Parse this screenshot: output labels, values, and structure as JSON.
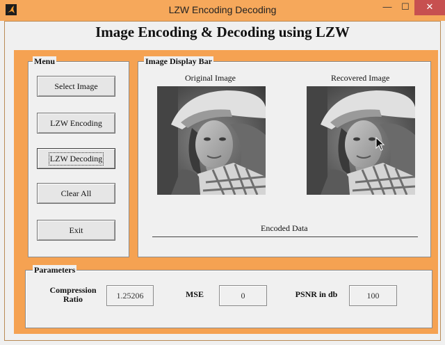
{
  "window": {
    "title": "LZW Encoding Decoding",
    "controls": {
      "minimize": "—",
      "maximize": "☐",
      "close": "✕"
    }
  },
  "heading": "Image Encoding & Decoding using LZW",
  "menu": {
    "title": "Menu",
    "buttons": [
      "Select Image",
      "LZW Encoding",
      "LZW Decoding",
      "Clear All",
      "Exit"
    ]
  },
  "display": {
    "title": "Image Display Bar",
    "original_label": "Original Image",
    "recovered_label": "Recovered Image",
    "encoded_label": "Encoded Data"
  },
  "parameters": {
    "title": "Parameters",
    "compression_label": "Compression Ratio",
    "compression_value": "1.25206",
    "mse_label": "MSE",
    "mse_value": "0",
    "psnr_label": "PSNR in db",
    "psnr_value": "100"
  },
  "colors": {
    "accent": "#f5a252",
    "panel": "#f0f0f0",
    "close": "#c75050"
  },
  "icons": {
    "app": "matlab-figure-icon",
    "cursor": "mouse-pointer-icon"
  }
}
